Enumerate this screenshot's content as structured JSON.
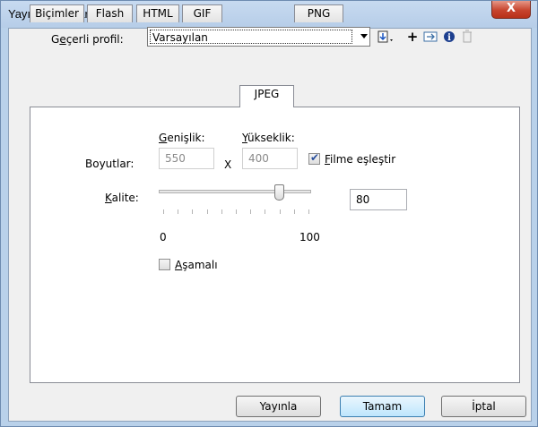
{
  "window": {
    "title": "Yayınlama Ayarları",
    "close_glyph": "X"
  },
  "profile": {
    "label_pre": "G",
    "label_ul": "e",
    "label_post": "çerli profil:",
    "value": "Varsayılan"
  },
  "tabs": [
    {
      "label": "Biçimler"
    },
    {
      "label": "Flash"
    },
    {
      "label": "HTML"
    },
    {
      "label": "GIF"
    },
    {
      "label": "JPEG"
    },
    {
      "label": "PNG"
    }
  ],
  "active_tab": "JPEG",
  "jpeg": {
    "width_label_ul": "G",
    "width_label_rest": "enişlik:",
    "height_label_ul": "Y",
    "height_label_rest": "ükseklik:",
    "dimensions_label": "Boyutlar:",
    "width_value": "550",
    "separator": "X",
    "height_value": "400",
    "match_movie_ul": "F",
    "match_movie_rest": "ilme eşleştir",
    "match_movie_checked": true,
    "quality_label_ul": "K",
    "quality_label_rest": "alite:",
    "quality_min": "0",
    "quality_max": "100",
    "quality_value": "80",
    "quality_level": 80,
    "progressive_ul": "A",
    "progressive_rest": "şamalı",
    "progressive_checked": false
  },
  "buttons": {
    "publish": "Yayınla",
    "ok": "Tamam",
    "cancel": "İptal"
  },
  "colors": {
    "title_bg": "#b9d1ea",
    "close_red": "#c7442e",
    "panel_bg": "#f0f0f0",
    "default_button": "#bee6fd"
  }
}
